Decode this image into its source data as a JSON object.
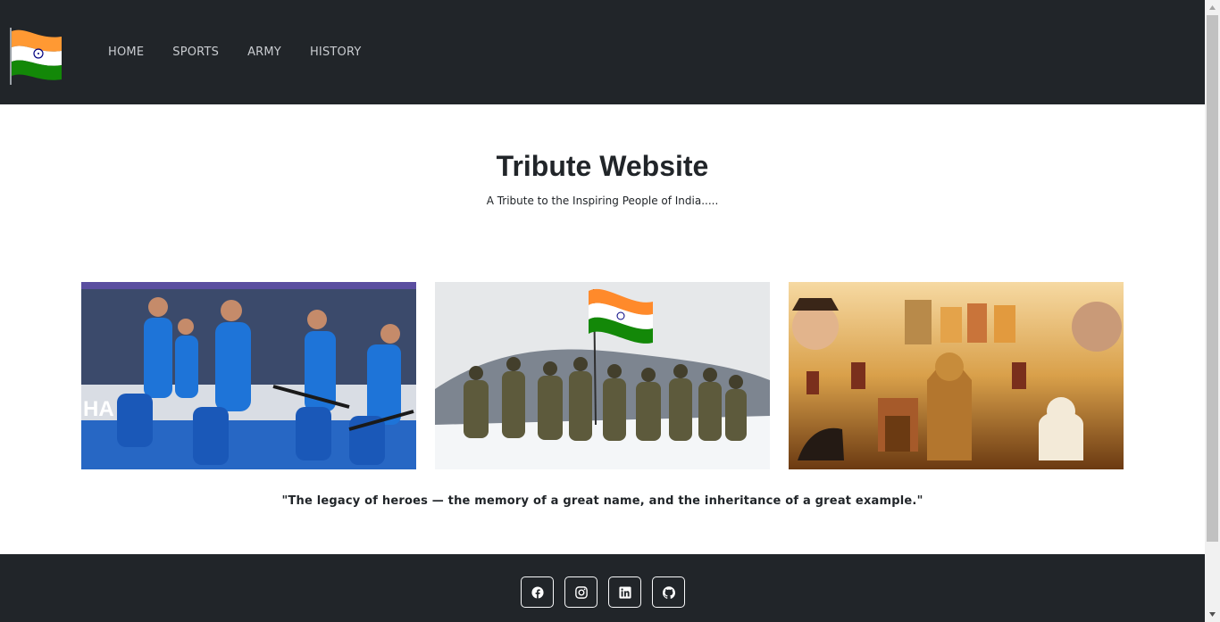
{
  "nav": {
    "brand_icon": "india-flag-icon",
    "items": [
      {
        "label": "HOME"
      },
      {
        "label": "SPORTS"
      },
      {
        "label": "ARMY"
      },
      {
        "label": "HISTORY"
      }
    ]
  },
  "hero": {
    "title": "Tribute Website",
    "subtitle": "A Tribute to the Inspiring People of India....."
  },
  "cards": [
    {
      "image": "indian-hockey-team-photo"
    },
    {
      "image": "indian-army-soldiers-flag-photo"
    },
    {
      "image": "indian-history-collage-photo"
    }
  ],
  "quote": "\"The legacy of heroes — the memory of a great name, and the inheritance of a great example.\"",
  "footer": {
    "social": [
      "facebook-icon",
      "instagram-icon",
      "linkedin-icon",
      "github-icon"
    ]
  },
  "colors": {
    "navbar_bg": "#212529",
    "footer_bg": "#212529",
    "saffron": "#ff9933",
    "green": "#138808"
  }
}
